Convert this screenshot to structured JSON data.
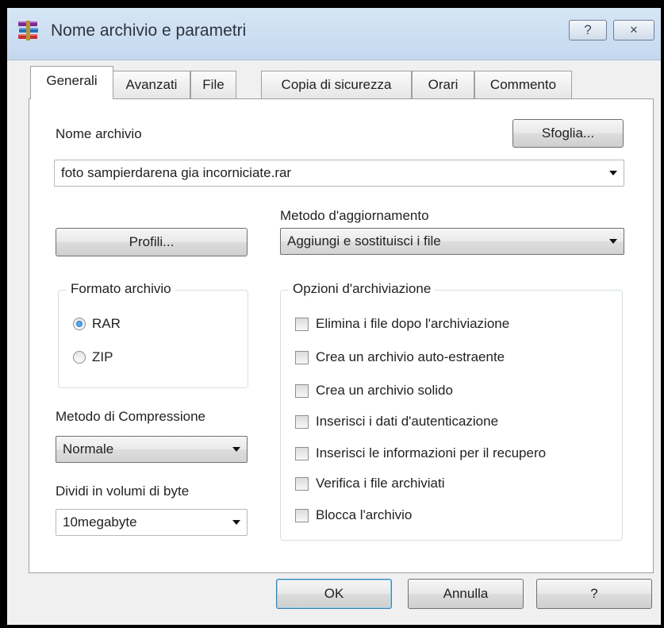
{
  "window": {
    "title": "Nome archivio e parametri",
    "help_caption": "?",
    "close_caption": "✕"
  },
  "tabs": [
    {
      "label": "Generali",
      "active": true
    },
    {
      "label": "Avanzati",
      "active": false
    },
    {
      "label": "File",
      "active": false
    },
    {
      "label": "Copia di sicurezza",
      "active": false
    },
    {
      "label": "Orari",
      "active": false
    },
    {
      "label": "Commento",
      "active": false
    }
  ],
  "archive_name": {
    "label": "Nome archivio",
    "browse_label": "Sfoglia...",
    "value": "foto sampierdarena gia incorniciate.rar"
  },
  "profiles_label": "Profili...",
  "update_method": {
    "label": "Metodo d'aggiornamento",
    "value": "Aggiungi e sostituisci i file"
  },
  "archive_format": {
    "title": "Formato archivio",
    "options": [
      {
        "label": "RAR",
        "selected": true
      },
      {
        "label": "ZIP",
        "selected": false
      }
    ]
  },
  "compression": {
    "label": "Metodo di Compressione",
    "value": "Normale"
  },
  "split_volumes": {
    "label": "Dividi in volumi di byte",
    "value": "10megabyte"
  },
  "archive_options": {
    "title": "Opzioni d'archiviazione",
    "items": [
      {
        "label": "Elimina i file dopo l'archiviazione",
        "checked": false
      },
      {
        "label": "Crea un archivio auto-estraente",
        "checked": false
      },
      {
        "label": "Crea un archivio solido",
        "checked": false
      },
      {
        "label": "Inserisci i dati d'autenticazione",
        "checked": false
      },
      {
        "label": "Inserisci le informazioni per il recupero",
        "checked": false
      },
      {
        "label": "Verifica i file archiviati",
        "checked": false
      },
      {
        "label": "Blocca l'archivio",
        "checked": false
      }
    ]
  },
  "footer": {
    "ok_label": "OK",
    "cancel_label": "Annulla",
    "help_label": "?"
  },
  "colors": {
    "titlebar": "#c4d8ee",
    "panel": "#ffffff",
    "dialog": "#f0f0f0",
    "radio_selected": "#1a5fb4"
  },
  "icons": {
    "app": "winrar-books-icon",
    "help": "help-question-icon",
    "close": "close-x-icon"
  }
}
